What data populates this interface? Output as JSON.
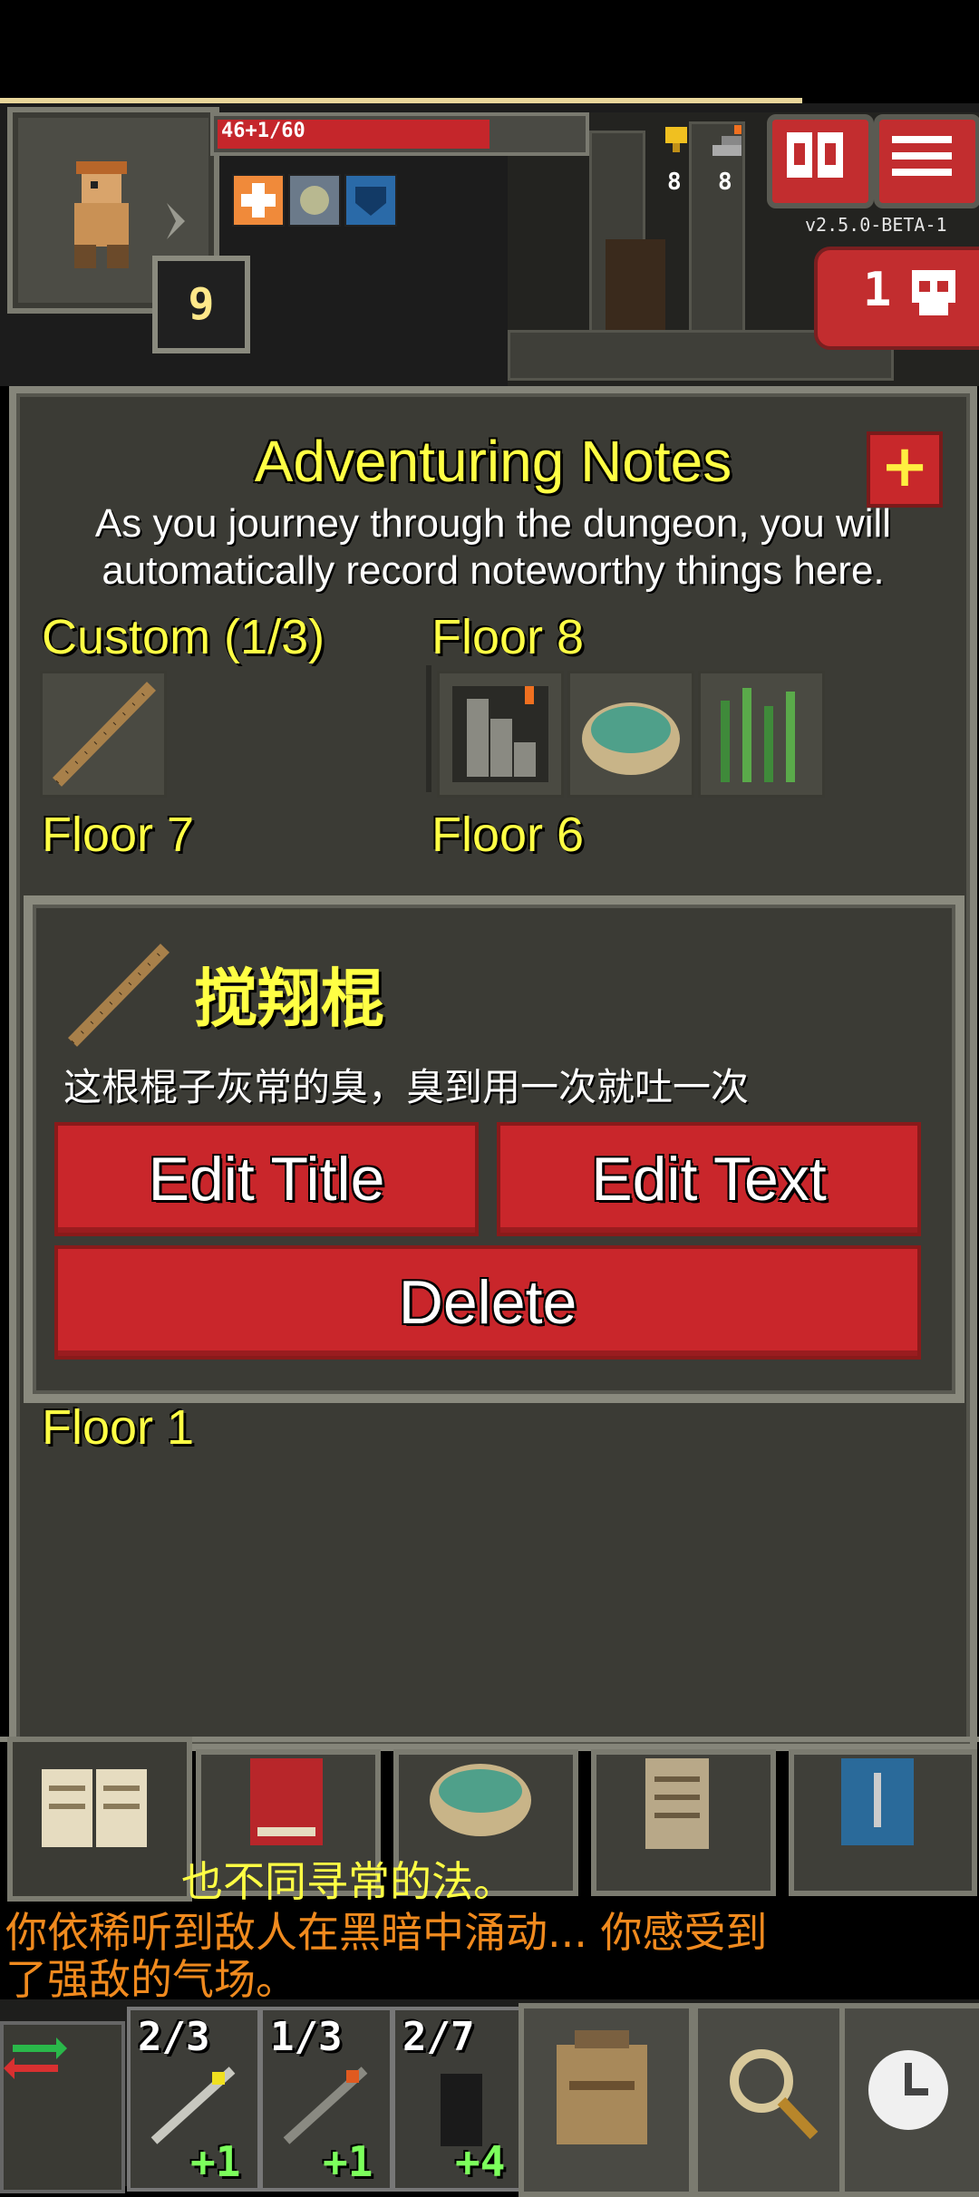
{
  "hud": {
    "hp_text": "46+1/60",
    "level": "9",
    "version": "v2.5.0-BETA-1",
    "danger_count": "1",
    "counters": [
      "8",
      "8"
    ]
  },
  "notes": {
    "title": "Adventuring Notes",
    "add_label": "+",
    "description_line1": "As you journey through the dungeon, you will",
    "description_line2": "automatically record noteworthy things here.",
    "sections": {
      "custom": "Custom (1/3)",
      "floor8": "Floor 8",
      "floor7": "Floor 7",
      "floor6": "Floor 6",
      "floor1": "Floor 1"
    }
  },
  "dialog": {
    "title": "搅翔棍",
    "text": "这根棍子灰常的臭，臭到用一次就吐一次",
    "edit_title": "Edit Title",
    "edit_text": "Edit Text",
    "delete": "Delete"
  },
  "log": {
    "line0": "也不同寻常的法。",
    "line1": "你依稀听到敌人在黑暗中涌动... 你感受到",
    "line2": "了强敌的气场。"
  },
  "quickslots": [
    {
      "count": "2/3",
      "plus": "+1"
    },
    {
      "count": "1/3",
      "plus": "+1"
    },
    {
      "count": "2/7",
      "plus": "+4"
    }
  ],
  "colors": {
    "accent_yellow": "#ffff44",
    "button_red": "#c9262b",
    "log_orange": "#f08a1e",
    "panel": "#3b3b35"
  }
}
